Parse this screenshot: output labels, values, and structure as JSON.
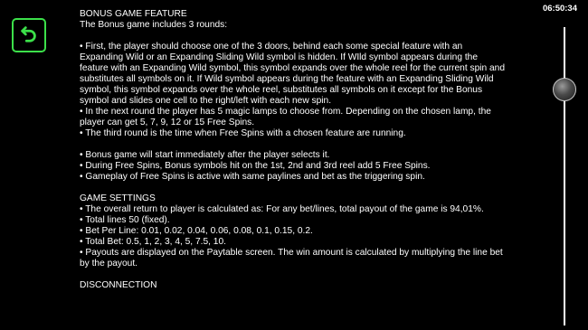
{
  "clock": "06:50:34",
  "back_button": {
    "icon": "back-arrow-icon",
    "color": "#3ce04a"
  },
  "content": {
    "bonus_heading": "BONUS GAME FEATURE",
    "bonus_intro": "The Bonus game includes 3 rounds:",
    "round1": "• First, the player should choose one of the 3 doors, behind each some special feature with an Expanding Wild or an Expanding Sliding Wild symbol is hidden. If WIld symbol appears during the feature with an Expanding Wild symbol, this symbol expands over the whole reel for the current spin and substitutes all symbols on it. If Wild symbol appears during the feature with an Expanding Sliding Wild symbol, this symbol expands over the whole reel, substitutes all symbols on it except for the Bonus symbol and slides one cell to the right/left with each new spin.",
    "round2": "• In the next round the player has 5 magic lamps to choose from. Depending on the chosen lamp, the player can get 5, 7, 9, 12 or 15 Free Spins.",
    "round3": "• The third round is the time when Free Spins with a chosen feature are running.",
    "note1": "• Bonus game will start immediately after the player selects it.",
    "note2": "• During Free Spins, Bonus symbols hit on the 1st, 2nd and 3rd reel add 5 Free Spins.",
    "note3": "• Gameplay of Free Spins is active with same paylines and bet as the triggering spin.",
    "settings_heading": "GAME SETTINGS",
    "settings1": "• The overall return to player is calculated as: For any bet/lines, total payout of the game is 94,01%.",
    "settings2": "• Total lines 50 (fixed).",
    "settings3": "• Bet Per Line: 0.01, 0.02, 0.04, 0.06, 0.08, 0.1, 0.15, 0.2.",
    "settings4": "• Total Bet: 0.5, 1, 2, 3, 4, 5, 7.5, 10.",
    "settings5": "• Payouts are displayed on the Paytable screen. The win amount is calculated by multiplying the line bet by the payout.",
    "disconnection_heading": "DISCONNECTION"
  },
  "scrollbar": {
    "position": 0.18
  }
}
